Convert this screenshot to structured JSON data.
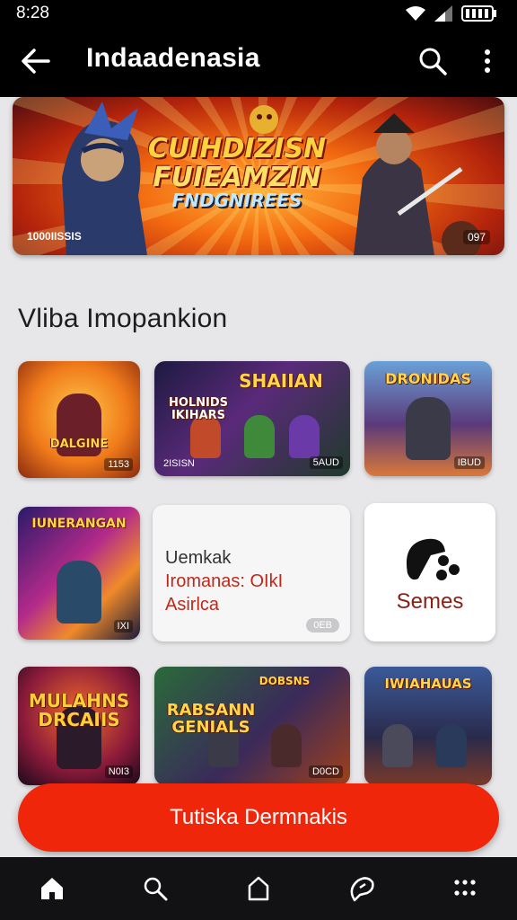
{
  "status_bar": {
    "time": "8:28"
  },
  "app_bar": {
    "title": "Indaadenasia"
  },
  "hero": {
    "title_line1": "CUIHDIZISN",
    "title_line2": "FUIEAMZIN",
    "title_line3": "FNDGNIREES",
    "badge_left": "1000IISSIS",
    "badge_right": "097"
  },
  "section": {
    "title": "Vliba Imopankion"
  },
  "tiles": [
    {
      "name": "DALGINE",
      "corner": "1153"
    },
    {
      "name": "SHAIIAN",
      "sub": "HOLNIDS IKIHARS",
      "corner_left": "2ISISN",
      "corner": "5AUD"
    },
    {
      "name": "DRONIDAS",
      "corner": "IBUD"
    },
    {
      "name": "IUNERANGAN",
      "corner": "IXI"
    },
    {
      "name": "MULAHNS DRCAIIS",
      "corner": "N0I3"
    },
    {
      "name": "RABSANN GENIALS",
      "sub": "DOBSNS",
      "corner": "D0CD"
    },
    {
      "name": "IWIAHAUAS",
      "corner": ""
    }
  ],
  "text_card": {
    "line1": "Uemkak",
    "line2": "Iromanas: OIkI",
    "line3": "Asirlca",
    "corner": "0EB"
  },
  "games_card": {
    "label": "Semes"
  },
  "cta": {
    "label": "Tutiska Dermnakis"
  },
  "colors": {
    "accent": "#f0260b",
    "bar": "#000000",
    "nav": "#121214"
  }
}
